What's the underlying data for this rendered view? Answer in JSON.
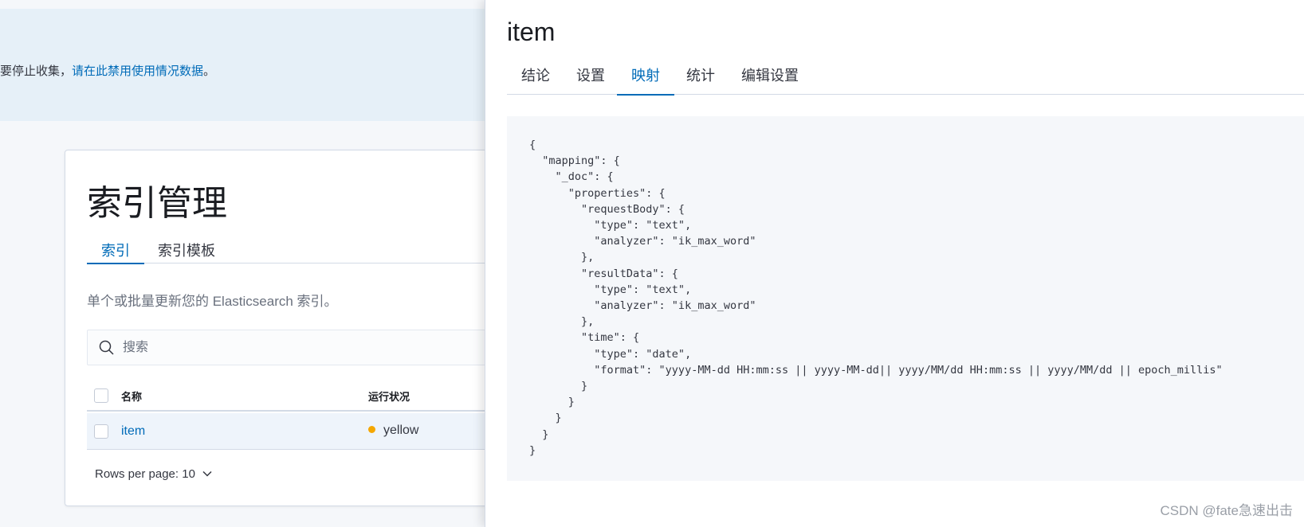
{
  "callout": {
    "prefix": "要停止收集，",
    "link": "请在此禁用使用情况数据",
    "suffix": "。"
  },
  "index_management": {
    "title": "索引管理",
    "tabs": [
      {
        "label": "索引",
        "active": true
      },
      {
        "label": "索引模板",
        "active": false
      }
    ],
    "description": "单个或批量更新您的 Elasticsearch 索引。",
    "search_placeholder": "搜索",
    "columns": {
      "name": "名称",
      "health": "运行状况"
    },
    "rows": [
      {
        "name": "item",
        "health": "yellow",
        "health_color": "#f5a700"
      }
    ],
    "rows_per_page": "Rows per page: 10"
  },
  "flyout": {
    "title": "item",
    "tabs": [
      {
        "label": "结论",
        "active": false
      },
      {
        "label": "设置",
        "active": false
      },
      {
        "label": "映射",
        "active": true
      },
      {
        "label": "统计",
        "active": false
      },
      {
        "label": "编辑设置",
        "active": false
      }
    ],
    "mapping_json": "{\n  \"mapping\": {\n    \"_doc\": {\n      \"properties\": {\n        \"requestBody\": {\n          \"type\": \"text\",\n          \"analyzer\": \"ik_max_word\"\n        },\n        \"resultData\": {\n          \"type\": \"text\",\n          \"analyzer\": \"ik_max_word\"\n        },\n        \"time\": {\n          \"type\": \"date\",\n          \"format\": \"yyyy-MM-dd HH:mm:ss || yyyy-MM-dd|| yyyy/MM/dd HH:mm:ss || yyyy/MM/dd || epoch_millis\"\n        }\n      }\n    }\n  }\n}"
  },
  "watermark": "CSDN @fate急速出击",
  "colors": {
    "accent": "#006bb8",
    "warning": "#f5a700"
  }
}
